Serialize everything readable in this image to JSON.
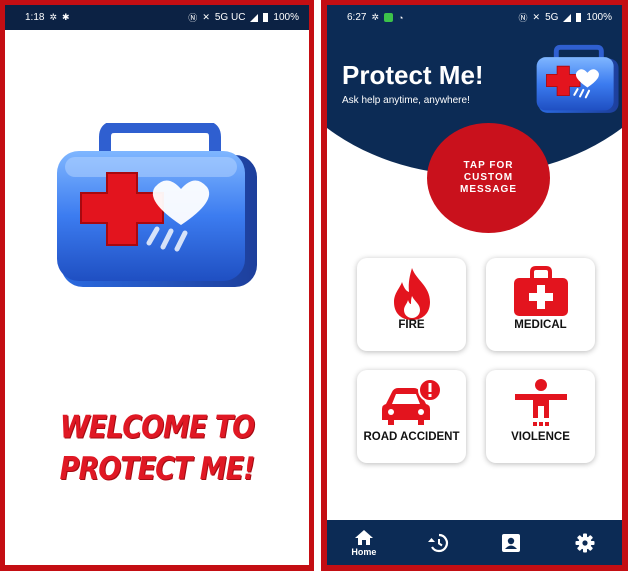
{
  "left_screen": {
    "status_bar": {
      "time": "1:18",
      "network": "5G UC",
      "battery": "100%"
    },
    "kit_icon": "first-aid-kit-icon",
    "welcome_text": "WELCOME TO PROTECT ME!"
  },
  "right_screen": {
    "status_bar": {
      "time": "6:27",
      "network": "5G",
      "battery": "100%"
    },
    "header": {
      "title": "Protect Me!",
      "subtitle": "Ask help anytime, anywhere!",
      "kit_icon": "first-aid-kit-icon"
    },
    "tap_button": {
      "label": "TAP FOR CUSTOM MESSAGE"
    },
    "emergency_cards": [
      {
        "label": "FIRE",
        "icon": "fire-icon"
      },
      {
        "label": "MEDICAL",
        "icon": "medical-kit-icon"
      },
      {
        "label": "ROAD ACCIDENT",
        "icon": "car-crash-icon"
      },
      {
        "label": "VIOLENCE",
        "icon": "person-alert-icon"
      }
    ],
    "bottom_nav": {
      "items": [
        {
          "label": "Home",
          "icon": "home-icon"
        },
        {
          "label": "",
          "icon": "history-icon"
        },
        {
          "label": "",
          "icon": "contacts-icon"
        },
        {
          "label": "",
          "icon": "settings-icon"
        }
      ]
    }
  },
  "colors": {
    "brand_red": "#c9111c",
    "navy": "#0c2b55",
    "welcome_red": "#e01824",
    "kit_blue": "#2f6ee6"
  }
}
